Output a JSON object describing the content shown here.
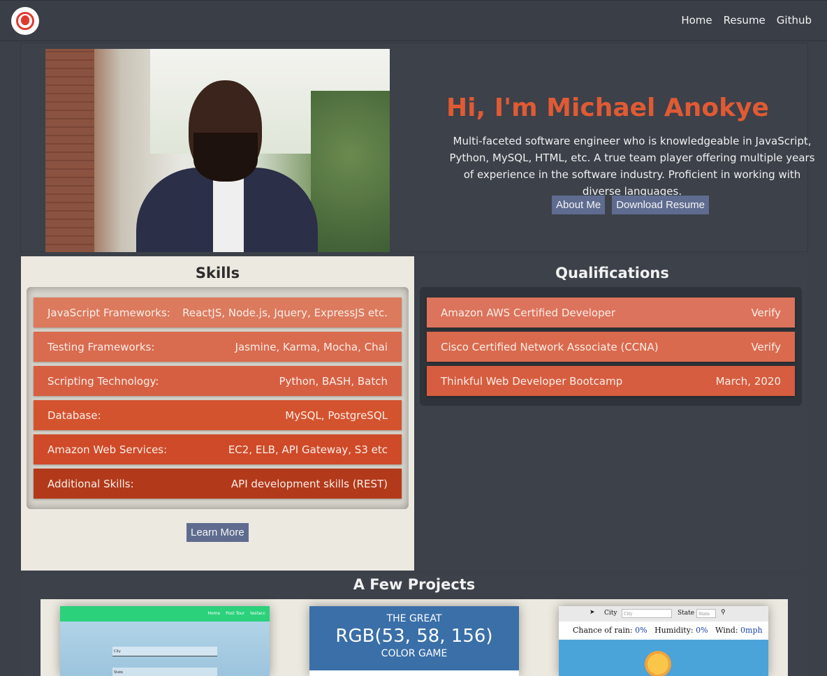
{
  "nav": {
    "links": [
      "Home",
      "Resume",
      "Github"
    ]
  },
  "hero": {
    "title": "Hi, I'm Michael Anokye",
    "description": "Multi-faceted software engineer who is knowledgeable in JavaScript, Python, MySQL, HTML, etc. A true team player offering multiple years of experience in the software industry. Proficient in working with diverse languages.",
    "about_button": "About Me",
    "resume_button": "Download Resume"
  },
  "skills": {
    "title": "Skills",
    "rows": [
      {
        "label": "JavaScript Frameworks:",
        "value": "ReactJS, Node.js, Jquery, ExpressJS etc.",
        "color": "#dc7a5e"
      },
      {
        "label": "Testing Frameworks:",
        "value": "Jasmine, Karma, Mocha, Chai",
        "color": "#d96b4f"
      },
      {
        "label": "Scripting Technology:",
        "value": "Python, BASH, Batch",
        "color": "#d65f42"
      },
      {
        "label": "Database:",
        "value": "MySQL, PostgreSQL",
        "color": "#d4532f"
      },
      {
        "label": "Amazon Web Services:",
        "value": "EC2, ELB, API Gateway, S3 etc",
        "color": "#cf4a28"
      },
      {
        "label": "Additional Skills:",
        "value": "API development skills (REST)",
        "color": "#b23a1b"
      }
    ],
    "learn_more": "Learn More"
  },
  "qualifications": {
    "title": "Qualifications",
    "rows": [
      {
        "label": "Amazon AWS Certified Developer",
        "value": "Verify",
        "color": "#dc735c"
      },
      {
        "label": "Cisco Certified Network Associate (CCNA)",
        "value": "Verify",
        "color": "#d96a4e"
      },
      {
        "label": "Thinkful Web Developer Bootcamp",
        "value": "March, 2020",
        "color": "#d65d3f"
      }
    ]
  },
  "projects": {
    "title": "A Few Projects",
    "p1": {
      "nav": [
        "Home",
        "Post Tour",
        "testacc"
      ],
      "field1": "City",
      "field2": "State"
    },
    "p2": {
      "line1": "THE GREAT",
      "line2": "RGB(53, 58, 156)",
      "line3": "COLOR GAME"
    },
    "p3": {
      "city_label": "City",
      "city_placeholder": "City",
      "state_label": "State",
      "state_placeholder": "State",
      "rain_label": "Chance of rain:",
      "rain_value": "0%",
      "humidity_label": "Humidity:",
      "humidity_value": "0%",
      "wind_label": "Wind:",
      "wind_value": "0mph"
    }
  }
}
